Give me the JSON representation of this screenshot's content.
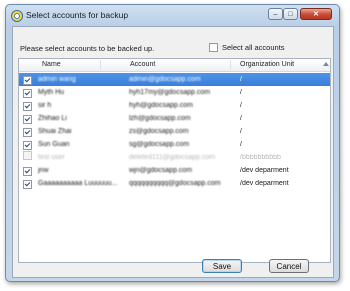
{
  "window": {
    "title": "Select accounts for backup",
    "controls": {
      "minimize": "–",
      "maximize": "□",
      "close": "✕"
    }
  },
  "prompt": "Please select accounts to be backed up.",
  "select_all": {
    "label": "Select all accounts",
    "checked": false
  },
  "columns": [
    "Name",
    "Account",
    "Organization Unit"
  ],
  "rows": [
    {
      "name": "admin wang",
      "account": "admin@gdocsapp.com",
      "ou": "/",
      "checked": true,
      "selected": true,
      "disabled": false
    },
    {
      "name": "Myth Hu",
      "account": "hyh17my@gdocsapp.com",
      "ou": "/",
      "checked": true,
      "selected": false,
      "disabled": false
    },
    {
      "name": "sir h",
      "account": "hyh@gdocsapp.com",
      "ou": "/",
      "checked": true,
      "selected": false,
      "disabled": false
    },
    {
      "name": "Zhihao Li",
      "account": "lzh@gdocsapp.com",
      "ou": "/",
      "checked": true,
      "selected": false,
      "disabled": false
    },
    {
      "name": "Shuai Zhai",
      "account": "zs@gdocsapp.com",
      "ou": "/",
      "checked": true,
      "selected": false,
      "disabled": false
    },
    {
      "name": "Sun Guan",
      "account": "sg@gdocsapp.com",
      "ou": "/",
      "checked": true,
      "selected": false,
      "disabled": false
    },
    {
      "name": "test user",
      "account": "deleted111@gdocsapp.com",
      "ou": "/bbbbbbbbbb",
      "checked": false,
      "selected": false,
      "disabled": true
    },
    {
      "name": "jnw",
      "account": "wjn@gdocsapp.com",
      "ou": "/dev deparment",
      "checked": true,
      "selected": false,
      "disabled": false
    },
    {
      "name": "Gaaaaaaaaaa Luuuuuu...",
      "account": "qqqqqqqqqq@gdocsapp.com",
      "ou": "/dev deparment",
      "checked": true,
      "selected": false,
      "disabled": false
    }
  ],
  "buttons": {
    "save": "Save",
    "cancel": "Cancel"
  }
}
